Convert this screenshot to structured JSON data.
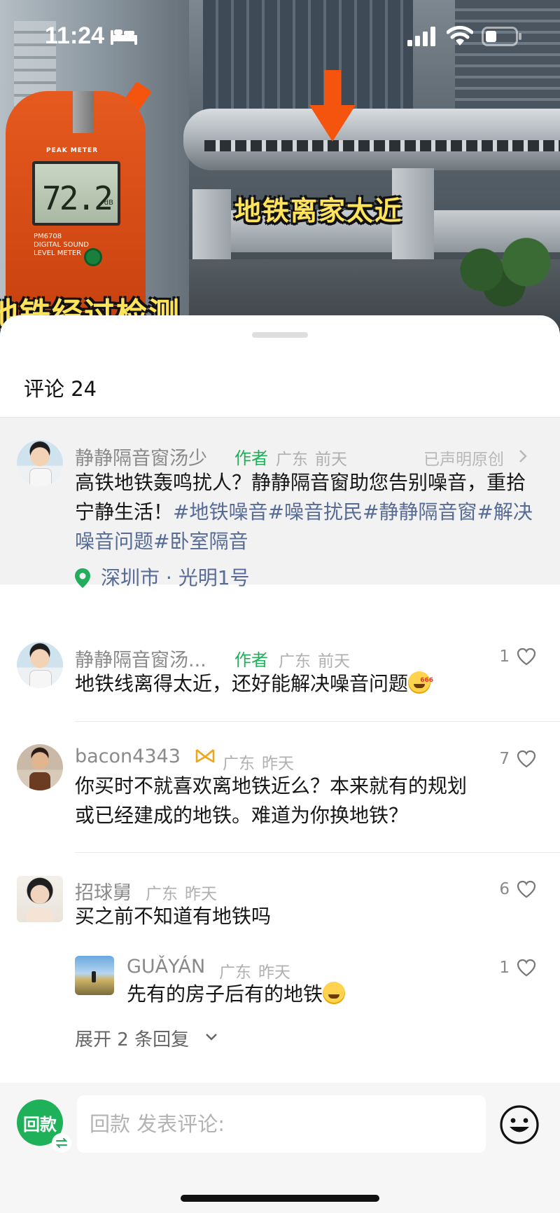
{
  "status_bar": {
    "time": "11:24",
    "icons": [
      "sleep-focus-icon",
      "cellular-signal-icon",
      "wifi-icon",
      "battery-icon"
    ]
  },
  "video": {
    "caption_main": "地铁离家太近",
    "caption_left": "地铁经过检测",
    "meter_brand": "PEAK METER",
    "meter_reading": "72.2",
    "meter_unit": "dB",
    "meter_model": "PM6708",
    "meter_model_desc": "DIGITAL SOUND LEVEL METER"
  },
  "sheet": {
    "title": "评论 24"
  },
  "author_post": {
    "name": "静静隔音窗汤少",
    "tag": "作者",
    "region": "广东",
    "time": "前天",
    "original_link": "已声明原创",
    "text_plain": "高铁地铁轰鸣扰人？静静隔音窗助您告别噪音，重拾宁静生活！",
    "hashtags": [
      "#地铁噪音",
      "#噪音扰民",
      "#静静隔音窗",
      "#解决噪音问题",
      "#卧室隔音"
    ],
    "location": "深圳市 · 光明1号"
  },
  "comments": [
    {
      "name": "静静隔音窗汤...",
      "tag": "作者",
      "region": "广东",
      "time": "前天",
      "likes": "1",
      "text": "地铁线离得太近，还好能解决噪音问题",
      "emoji": "666"
    },
    {
      "name": "bacon4343",
      "region": "广东",
      "time": "昨天",
      "likes": "7",
      "text_line1": "你买时不就喜欢离地铁近么？本来就有的规划",
      "text_line2": "或已经建成的地铁。难道为你换地铁？"
    },
    {
      "name": "招球舅",
      "region": "广东",
      "time": "昨天",
      "likes": "6",
      "text": "买之前不知道有地铁吗",
      "reply": {
        "name": "GUǍYÁN",
        "region": "广东",
        "time": "昨天",
        "likes": "1",
        "text": "先有的房子后有的地铁"
      },
      "expand_label": "展开 2 条回复"
    }
  ],
  "input_bar": {
    "avatar_text": "回款",
    "placeholder": "回款 发表评论:"
  },
  "colors": {
    "author_tag": "#21ad5c",
    "link_blue": "#576b95",
    "caption_yellow": "#ffe35a",
    "arrow_orange": "#f5540f"
  }
}
